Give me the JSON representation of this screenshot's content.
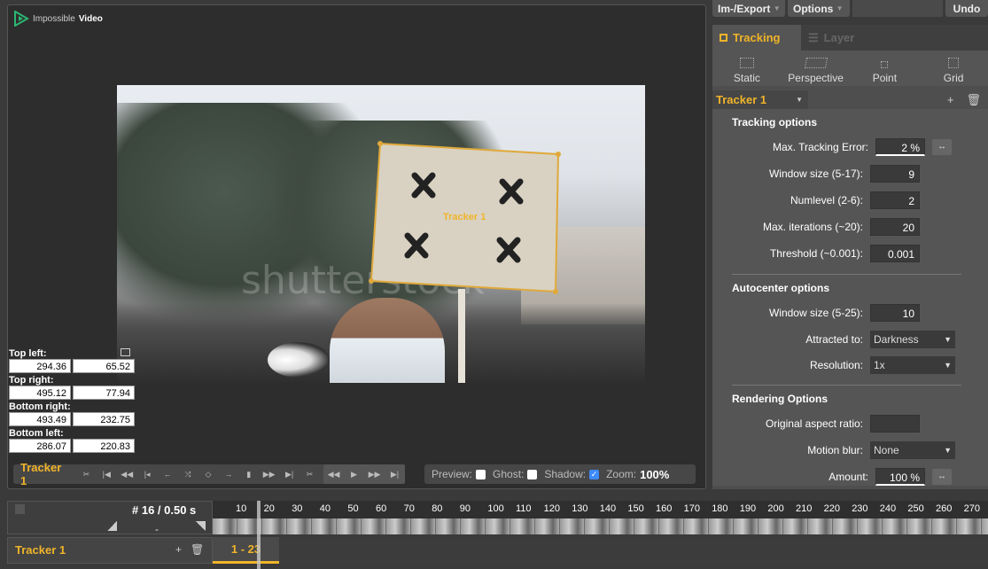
{
  "app": {
    "brand_regular": "Impossible",
    "brand_bold": "Video"
  },
  "toolbar": {
    "import_export": "Im-/Export",
    "options": "Options",
    "undo": "Undo"
  },
  "video": {
    "watermark": "shutterstock",
    "tracker_label": "Tracker 1"
  },
  "coords": {
    "top_left": {
      "label": "Top left:",
      "x": "294.36",
      "y": "65.52"
    },
    "top_right": {
      "label": "Top right:",
      "x": "495.12",
      "y": "77.94"
    },
    "bottom_right": {
      "label": "Bottom right:",
      "x": "493.49",
      "y": "232.75"
    },
    "bottom_left": {
      "label": "Bottom left:",
      "x": "286.07",
      "y": "220.83"
    }
  },
  "transport": {
    "tracker_name": "Tracker 1"
  },
  "view_options": {
    "preview": "Preview:",
    "ghost": "Ghost:",
    "shadow": "Shadow:",
    "zoom_label": "Zoom:",
    "zoom_value": "100%",
    "shadow_checked": true
  },
  "panel": {
    "tabs": [
      {
        "label": "Tracking",
        "active": true
      },
      {
        "label": "Layer",
        "active": false
      }
    ],
    "types": [
      "Static",
      "Perspective",
      "Point",
      "Grid"
    ],
    "tracker_select": "Tracker 1",
    "tracking_options": {
      "title": "Tracking options",
      "fields": [
        {
          "label": "Max. Tracking Error:",
          "value": "2 %"
        },
        {
          "label": "Window size (5-17):",
          "value": "9"
        },
        {
          "label": "Numlevel (2-6):",
          "value": "2"
        },
        {
          "label": "Max. iterations (~20):",
          "value": "20"
        },
        {
          "label": "Threshold (~0.001):",
          "value": "0.001"
        }
      ]
    },
    "autocenter": {
      "title": "Autocenter options",
      "window_size": {
        "label": "Window size (5-25):",
        "value": "10"
      },
      "attracted": {
        "label": "Attracted to:",
        "value": "Darkness"
      },
      "resolution": {
        "label": "Resolution:",
        "value": "1x"
      }
    },
    "rendering": {
      "title": "Rendering Options",
      "aspect": {
        "label": "Original aspect ratio:",
        "value": ""
      },
      "motion_blur": {
        "label": "Motion blur:",
        "value": "None"
      },
      "amount": {
        "label": "Amount:",
        "value": "100 %"
      }
    }
  },
  "timeline": {
    "frame": "# 16 / 0.50 s",
    "dash": "-",
    "ticks": [
      "10",
      "20",
      "30",
      "40",
      "50",
      "60",
      "70",
      "80",
      "90",
      "100",
      "110",
      "120",
      "130",
      "140",
      "150",
      "160",
      "170",
      "180",
      "190",
      "200",
      "210",
      "220",
      "230",
      "240",
      "250",
      "260",
      "270"
    ],
    "track_name": "Tracker 1",
    "segment": "1 - 23"
  }
}
